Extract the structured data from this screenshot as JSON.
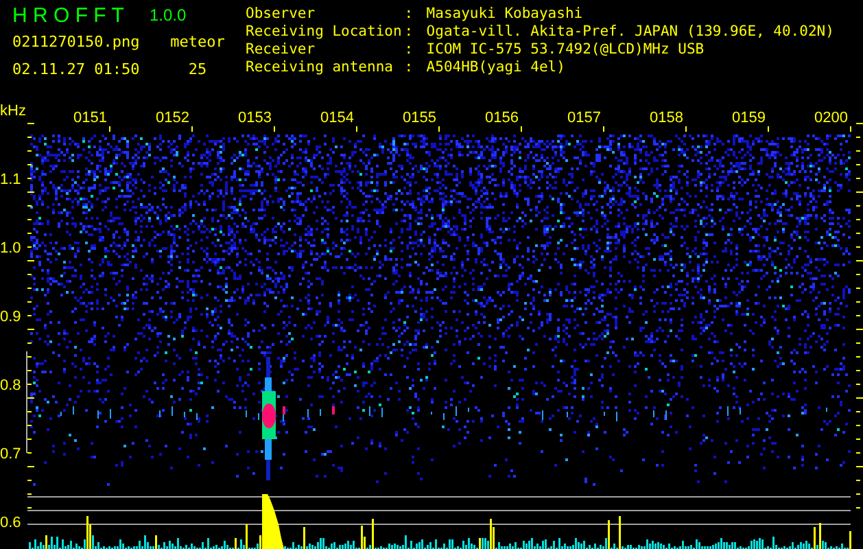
{
  "app": {
    "title": "H R O F F T",
    "version": "1.0.0",
    "filename": "0211270150.png",
    "datetime": "02.11.27 01:50",
    "meteor_label": "meteor",
    "meteor_count": "25"
  },
  "info": [
    {
      "label": "Observer",
      "separator": ":",
      "value": "Masayuki Kobayashi"
    },
    {
      "label": "Receiving Location",
      "separator": ":",
      "value": "Ogata-vill. Akita-Pref. JAPAN (139.96E, 40.02N)"
    },
    {
      "label": "Receiver",
      "separator": ":",
      "value": "ICOM IC-575 53.7492(@LCD)MHz USB"
    },
    {
      "label": "Receiving antenna",
      "separator": ":",
      "value": "A504HB(yagi 4el)"
    }
  ],
  "spectrogram": {
    "unit": "kHz",
    "time_labels": [
      "0151",
      "0152",
      "0153",
      "0154",
      "0155",
      "0156",
      "0157",
      "0158",
      "0159",
      "0200"
    ],
    "freq_labels": [
      "1.1",
      "1.0",
      "0.9",
      "0.8",
      "0.7",
      "0.6"
    ]
  }
}
